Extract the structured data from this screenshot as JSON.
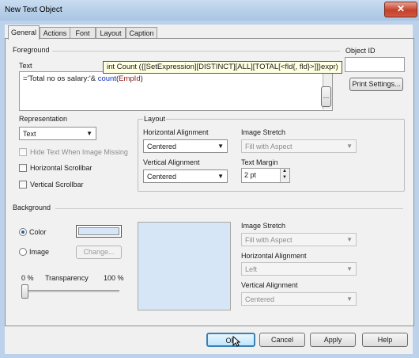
{
  "window": {
    "title": "New Text Object",
    "close_glyph": "✕"
  },
  "tabs": [
    {
      "label": "General",
      "active": true
    },
    {
      "label": "Actions"
    },
    {
      "label": "Font"
    },
    {
      "label": "Layout"
    },
    {
      "label": "Caption"
    }
  ],
  "foreground": {
    "group_label": "Foreground",
    "text_label": "Text",
    "text_value_prefix": "='Total no os salary:'& ",
    "text_value_func": "count",
    "text_value_open": "(",
    "text_value_field": "EmpId",
    "text_value_close": ")",
    "ellipsis_label": "...",
    "object_id_label": "Object ID",
    "object_id_value": "",
    "print_settings_label": "Print Settings...",
    "tooltip": "int Count ({[SetExpression][DISTINCT][ALL][TOTAL[<fld{, fld}>]]}expr)"
  },
  "representation": {
    "label": "Representation",
    "value": "Text",
    "hide_text_label": "Hide Text When Image Missing",
    "hscroll_label": "Horizontal Scrollbar",
    "vscroll_label": "Vertical Scrollbar"
  },
  "layout": {
    "group_label": "Layout",
    "h_align_label": "Horizontal Alignment",
    "h_align_value": "Centered",
    "v_align_label": "Vertical Alignment",
    "v_align_value": "Centered",
    "image_stretch_label": "Image Stretch",
    "image_stretch_value": "Fill with Aspect",
    "text_margin_label": "Text Margin",
    "text_margin_value": "2 pt"
  },
  "background": {
    "group_label": "Background",
    "color_label": "Color",
    "image_label": "Image",
    "change_label": "Change...",
    "transparency_min": "0 %",
    "transparency_label": "Transparency",
    "transparency_max": "100 %",
    "transparency_value": 0,
    "swatch_color": "#d6e6f6",
    "image_stretch_label": "Image Stretch",
    "image_stretch_value": "Fill with Aspect",
    "h_align_label": "Horizontal Alignment",
    "h_align_value": "Left",
    "v_align_label": "Vertical Alignment",
    "v_align_value": "Centered"
  },
  "footer": {
    "ok_label": "OK",
    "cancel_label": "Cancel",
    "apply_label": "Apply",
    "help_label": "Help"
  },
  "icons": {
    "dropdown_arrow": "▼",
    "spin_up": "▲",
    "spin_down": "▼"
  }
}
